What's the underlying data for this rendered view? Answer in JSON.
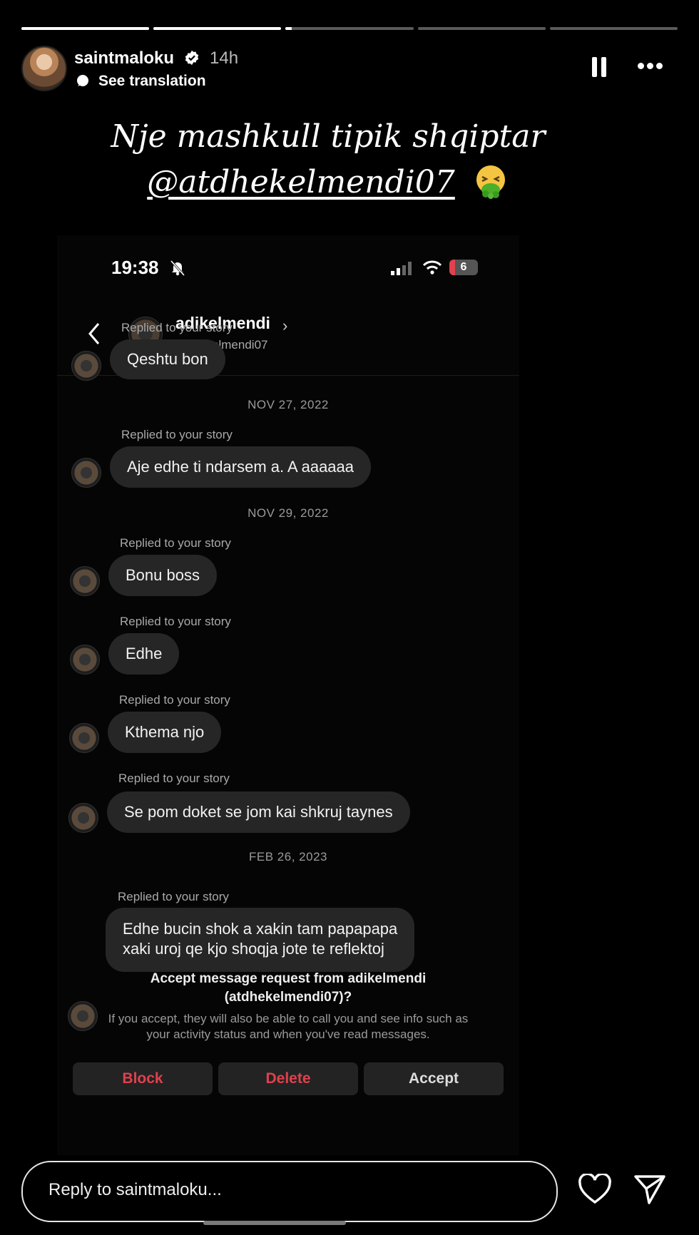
{
  "story": {
    "progress": [
      1.0,
      1.0,
      0.05,
      0.0,
      0.0
    ],
    "username": "saintmaloku",
    "time_ago": "14h",
    "see_translation": "See translation",
    "caption_line1": "Nje mashkull tipik shqiptar",
    "caption_mention": "@atdhekelmendi07",
    "caption_emoji": "nauseated-face-icon"
  },
  "screenshot": {
    "status_time": "19:38",
    "battery": "6",
    "chat_name": "adikelmendi",
    "chat_chevron": "›",
    "chat_handle": "atdhekelmendi07",
    "messages": [
      {
        "replied": "Replied to your story",
        "text": "Qeshtu bon"
      },
      {
        "date": "NOV 27, 2022"
      },
      {
        "replied": "Replied to your story",
        "text": "Aje edhe ti ndarsem a. A aaaaaa"
      },
      {
        "date": "NOV 29, 2022"
      },
      {
        "replied": "Replied to your story",
        "text": "Bonu boss"
      },
      {
        "replied": "Replied to your story",
        "text": "Edhe"
      },
      {
        "replied": "Replied to your story",
        "text": "Kthema njo"
      },
      {
        "replied": "Replied to your story",
        "text": "Se pom doket se jom kai shkruj taynes"
      },
      {
        "date": "FEB 26, 2023"
      },
      {
        "replied": "Replied to your story",
        "text_line1": "Edhe bucin shok a xakin tam papapapa",
        "text_line2": "xaki uroj qe kjo shoqja jote te reflektoj"
      }
    ],
    "request_title_line1": "Accept message request from adikelmendi",
    "request_title_line2": "(atdhekelmendi07)?",
    "request_desc_line1": "If you accept, they will also be able to call you and see info such as",
    "request_desc_line2": "your activity status and when you've read messages.",
    "block_label": "Block",
    "delete_label": "Delete",
    "accept_label": "Accept"
  },
  "reply": {
    "placeholder": "Reply to saintmaloku..."
  },
  "colors": {
    "background": "#000000",
    "bubble": "#262626",
    "danger": "#e0414d"
  }
}
